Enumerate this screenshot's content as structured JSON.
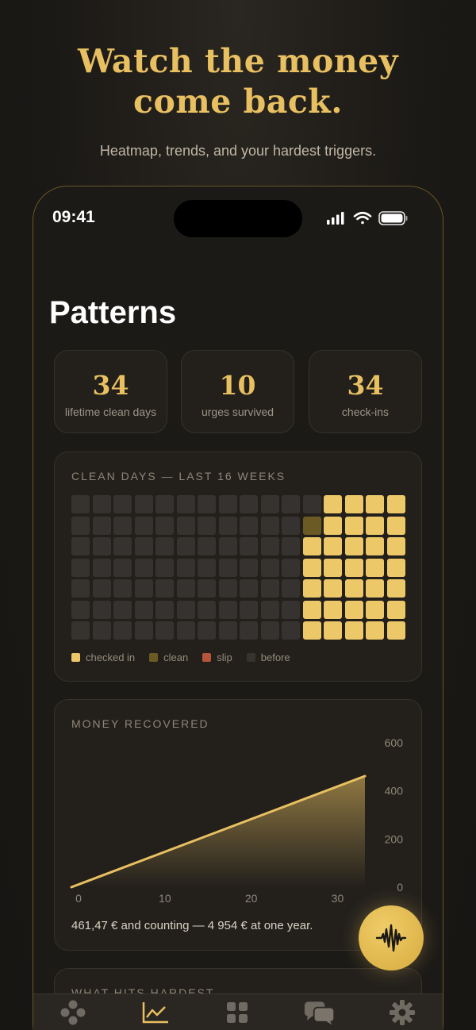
{
  "hero": {
    "title_line1": "Watch the money",
    "title_line2": "come back.",
    "subtitle": "Heatmap, trends, and your hardest triggers."
  },
  "status_bar": {
    "time": "09:41",
    "icons": [
      "cellular-icon",
      "wifi-icon",
      "battery-icon"
    ]
  },
  "page_title": "Patterns",
  "stats": [
    {
      "value": "34",
      "label": "lifetime clean days"
    },
    {
      "value": "10",
      "label": "urges survived"
    },
    {
      "value": "34",
      "label": "check-ins"
    }
  ],
  "heatmap": {
    "label": "CLEAN DAYS — LAST 16 WEEKS",
    "weeks": 16,
    "days": 7,
    "status_cell_counts": {
      "before": 78,
      "clean": 1,
      "checked_in": 33,
      "slip": 0
    },
    "legend": [
      {
        "key": "checked",
        "label": "checked in",
        "color": "#ecc869"
      },
      {
        "key": "clean",
        "label": "clean",
        "color": "#6b5a24"
      },
      {
        "key": "slip",
        "label": "slip",
        "color": "#b5553a"
      },
      {
        "key": "before",
        "label": "before",
        "color": "#353230"
      }
    ]
  },
  "money": {
    "label": "MONEY RECOVERED",
    "caption": "461,47 € and counting — 4 954 € at one year.",
    "accent": "#e8c061"
  },
  "chart_data": {
    "type": "area",
    "title": "MONEY RECOVERED",
    "x": [
      0,
      34
    ],
    "y": [
      0,
      461.47
    ],
    "x_ticks": [
      0,
      10,
      20,
      30
    ],
    "y_ticks": [
      0,
      200,
      400,
      600
    ],
    "xlim": [
      0,
      34
    ],
    "ylim": [
      0,
      600
    ],
    "y_axis_side": "right",
    "grid": false
  },
  "third_section": {
    "label": "WHAT HITS HARDEST"
  },
  "fab": {
    "icon": "waveform-icon"
  },
  "tabs": [
    {
      "name": "tab-home",
      "icon": "dots-icon",
      "active": false
    },
    {
      "name": "tab-patterns",
      "icon": "chart-icon",
      "active": true
    },
    {
      "name": "tab-tools",
      "icon": "grid-icon",
      "active": false
    },
    {
      "name": "tab-chat",
      "icon": "chat-icon",
      "active": false
    },
    {
      "name": "tab-settings",
      "icon": "gear-icon",
      "active": false
    }
  ],
  "colors": {
    "accent": "#e8c061",
    "background": "#1b1916",
    "card": "#23201c"
  }
}
